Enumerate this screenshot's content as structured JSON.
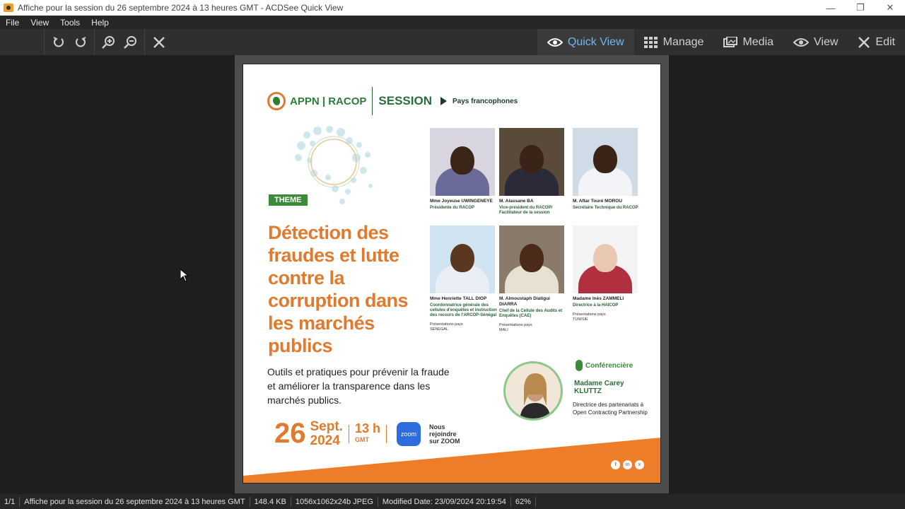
{
  "window": {
    "title": "Affiche pour la session du 26 septembre 2024 à 13 heures GMT - ACDSee Quick View",
    "minimize": "—",
    "restore": "❐",
    "close": "✕"
  },
  "menu": [
    "File",
    "View",
    "Tools",
    "Help"
  ],
  "modes": [
    {
      "label": "Quick View",
      "icon": "eye-icon",
      "active": true
    },
    {
      "label": "Manage",
      "icon": "grid-icon",
      "active": false
    },
    {
      "label": "Media",
      "icon": "media-icon",
      "active": false
    },
    {
      "label": "View",
      "icon": "eye-icon",
      "active": false
    },
    {
      "label": "Edit",
      "icon": "edit-icon",
      "active": false
    }
  ],
  "poster": {
    "logo": "APPN | RACOP",
    "session": "SESSION",
    "pays": "Pays francophones",
    "theme": "THEME",
    "title": "Détection des fraudes et lutte contre la corruption dans les marchés publics",
    "subtitle": "Outils et pratiques pour prévenir la fraude et améliorer la transparence dans les marchés publics.",
    "date_day": "26",
    "date_month": "Sept.",
    "date_year": "2024",
    "time": "13 h",
    "time_zone": "GMT",
    "zoom_badge": "zoom",
    "zoom_text": "Nous rejoindre sur ZOOM",
    "speakers": [
      {
        "name": "Mme Joyeuse UWINGENEYE",
        "role": "Présidente du RACOP",
        "pres": "",
        "country": ""
      },
      {
        "name": "M. Alassane BA",
        "role": "Vice-président du RACOP/ Facilitateur de la session",
        "pres": "",
        "country": ""
      },
      {
        "name": "M. Aftar Touré MOROU",
        "role": "Secrétaire Technique du RACOP",
        "pres": "",
        "country": ""
      },
      {
        "name": "Mme Henriette TALL DIOP",
        "role": "Coordonnatrice générale des cellules d'enquêtes et instruction des recours de l'ARCOP-Sénégal",
        "pres": "Présentations pays",
        "country": "SENEGAL"
      },
      {
        "name": "M. Almoustaph Diatigui DIARRA",
        "role": "Chef de la Cellule des Audits et Enquêtes (CAE)",
        "pres": "Présentations pays",
        "country": "MALI"
      },
      {
        "name": "Madame Inès ZAMMELI",
        "role": "Directrice à la HAICOP",
        "pres": "Présentations pays",
        "country": "TUNISIE"
      }
    ],
    "conference_label": "Conférencière",
    "conference_name": "Madame Carey KLUTTZ",
    "conference_role": "Directrice des partenariats à Open Contracting Partnership",
    "socials": [
      "f",
      "in",
      "x"
    ]
  },
  "status": {
    "index": "1/1",
    "filename": "Affiche pour la session du 26 septembre 2024 à 13 heures GMT",
    "size": "148.4 KB",
    "dims": "1056x1062x24b JPEG",
    "modified": "Modified Date: 23/09/2024 20:19:54",
    "zoom": "62%"
  },
  "colors": {
    "accent": "#6fb6f5",
    "orange": "#e07a2e",
    "green": "#3d8a3a"
  }
}
